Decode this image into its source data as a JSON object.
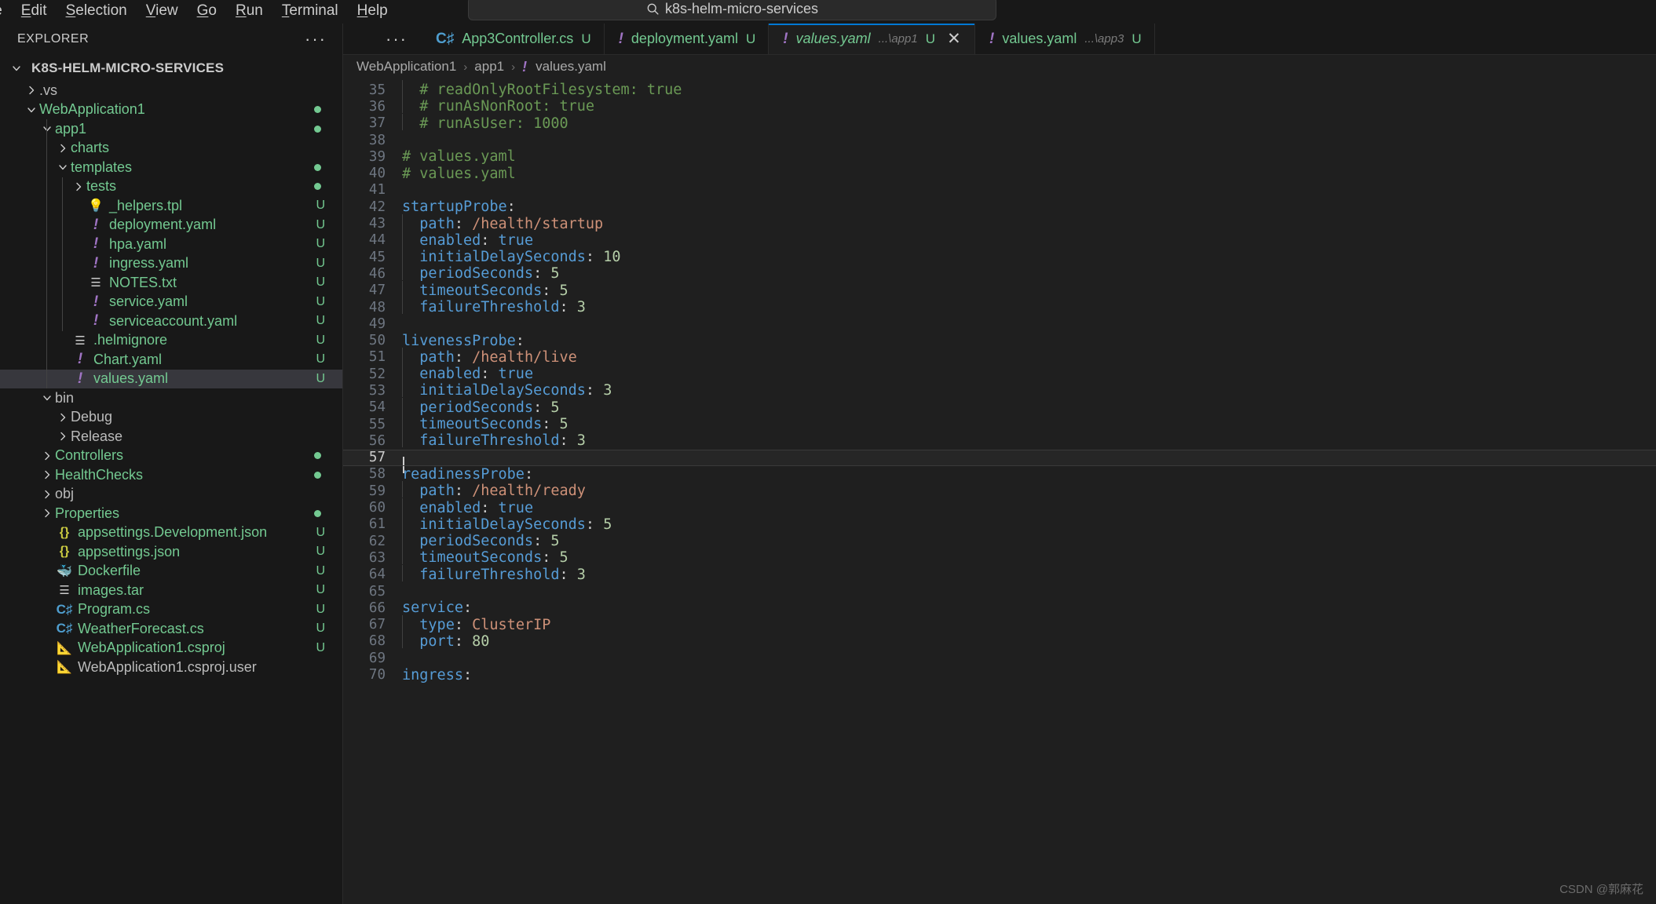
{
  "titlebar": {
    "menu": [
      "File",
      "Edit",
      "Selection",
      "View",
      "Go",
      "Run",
      "Terminal",
      "Help"
    ],
    "menu_first_visible": "le",
    "back_icon": "arrow-left-icon",
    "forward_icon": "arrow-right-icon",
    "search_icon": "search-icon",
    "search_value": "k8s-helm-micro-services"
  },
  "sidebar": {
    "title": "EXPLORER",
    "more_actions": "···",
    "root": "K8S-HELM-MICRO-SERVICES",
    "items": [
      {
        "label": ".vs",
        "indent": 1,
        "type": "folder",
        "state": "collapsed",
        "color": "dim"
      },
      {
        "label": "WebApplication1",
        "indent": 1,
        "type": "folder",
        "state": "expanded",
        "color": "mod",
        "dot": true
      },
      {
        "label": "app1",
        "indent": 2,
        "type": "folder",
        "state": "expanded",
        "color": "mod",
        "dot": true
      },
      {
        "label": "charts",
        "indent": 3,
        "type": "folder",
        "state": "collapsed",
        "color": "mod"
      },
      {
        "label": "templates",
        "indent": 3,
        "type": "folder",
        "state": "expanded",
        "color": "mod",
        "dot": true
      },
      {
        "label": "tests",
        "indent": 4,
        "type": "folder",
        "state": "collapsed",
        "color": "mod",
        "dot": true
      },
      {
        "label": "_helpers.tpl",
        "indent": 4,
        "type": "tpl",
        "color": "mod",
        "badge": "U"
      },
      {
        "label": "deployment.yaml",
        "indent": 4,
        "type": "yaml",
        "color": "mod",
        "badge": "U"
      },
      {
        "label": "hpa.yaml",
        "indent": 4,
        "type": "yaml",
        "color": "mod",
        "badge": "U"
      },
      {
        "label": "ingress.yaml",
        "indent": 4,
        "type": "yaml",
        "color": "mod",
        "badge": "U"
      },
      {
        "label": "NOTES.txt",
        "indent": 4,
        "type": "txt",
        "color": "mod",
        "badge": "U"
      },
      {
        "label": "service.yaml",
        "indent": 4,
        "type": "yaml",
        "color": "mod",
        "badge": "U"
      },
      {
        "label": "serviceaccount.yaml",
        "indent": 4,
        "type": "yaml",
        "color": "mod",
        "badge": "U"
      },
      {
        "label": ".helmignore",
        "indent": 3,
        "type": "txt",
        "color": "mod",
        "badge": "U"
      },
      {
        "label": "Chart.yaml",
        "indent": 3,
        "type": "yaml",
        "color": "mod",
        "badge": "U"
      },
      {
        "label": "values.yaml",
        "indent": 3,
        "type": "yaml",
        "color": "mod",
        "badge": "U",
        "selected": true
      },
      {
        "label": "bin",
        "indent": 2,
        "type": "folder",
        "state": "expanded",
        "color": "dim"
      },
      {
        "label": "Debug",
        "indent": 3,
        "type": "folder",
        "state": "collapsed",
        "color": "dim"
      },
      {
        "label": "Release",
        "indent": 3,
        "type": "folder",
        "state": "collapsed",
        "color": "dim"
      },
      {
        "label": "Controllers",
        "indent": 2,
        "type": "folder",
        "state": "collapsed",
        "color": "mod",
        "dot": true
      },
      {
        "label": "HealthChecks",
        "indent": 2,
        "type": "folder",
        "state": "collapsed",
        "color": "mod",
        "dot": true
      },
      {
        "label": "obj",
        "indent": 2,
        "type": "folder",
        "state": "collapsed",
        "color": "dim"
      },
      {
        "label": "Properties",
        "indent": 2,
        "type": "folder",
        "state": "collapsed",
        "color": "mod",
        "dot": true
      },
      {
        "label": "appsettings.Development.json",
        "indent": 2,
        "type": "json",
        "color": "mod",
        "badge": "U"
      },
      {
        "label": "appsettings.json",
        "indent": 2,
        "type": "json",
        "color": "mod",
        "badge": "U"
      },
      {
        "label": "Dockerfile",
        "indent": 2,
        "type": "docker",
        "color": "mod",
        "badge": "U"
      },
      {
        "label": "images.tar",
        "indent": 2,
        "type": "txt",
        "color": "mod",
        "badge": "U"
      },
      {
        "label": "Program.cs",
        "indent": 2,
        "type": "cs",
        "color": "mod",
        "badge": "U"
      },
      {
        "label": "WeatherForecast.cs",
        "indent": 2,
        "type": "cs",
        "color": "mod",
        "badge": "U"
      },
      {
        "label": "WebApplication1.csproj",
        "indent": 2,
        "type": "csproj",
        "color": "mod",
        "badge": "U"
      },
      {
        "label": "WebApplication1.csproj.user",
        "indent": 2,
        "type": "csproj",
        "color": "dim"
      }
    ]
  },
  "tabs": [
    {
      "label": "App3Controller.cs",
      "icon": "csharp-icon",
      "desc": "",
      "badge": "U",
      "active": false,
      "closable": false
    },
    {
      "label": "deployment.yaml",
      "icon": "yaml-icon",
      "desc": "",
      "badge": "U",
      "active": false,
      "closable": false
    },
    {
      "label": "values.yaml",
      "icon": "yaml-icon",
      "desc": "...\\app1",
      "badge": "U",
      "active": true,
      "closable": true,
      "close_icon": "close-icon"
    },
    {
      "label": "values.yaml",
      "icon": "yaml-icon",
      "desc": "...\\app3",
      "badge": "U",
      "active": false,
      "closable": false
    }
  ],
  "breadcrumbs": {
    "items": [
      "WebApplication1",
      "app1"
    ],
    "file": "values.yaml",
    "file_icon": "yaml-icon",
    "separator": "›"
  },
  "code": {
    "first_line": 35,
    "cursor_line": 57,
    "lines": [
      {
        "n": 35,
        "indent_guide": true,
        "tokens": [
          {
            "t": "  ",
            "c": "pun"
          },
          {
            "t": "# readOnlyRootFilesystem: true",
            "c": "com"
          }
        ]
      },
      {
        "n": 36,
        "indent_guide": true,
        "tokens": [
          {
            "t": "  ",
            "c": "pun"
          },
          {
            "t": "# runAsNonRoot: true",
            "c": "com"
          }
        ]
      },
      {
        "n": 37,
        "indent_guide": true,
        "tokens": [
          {
            "t": "  ",
            "c": "pun"
          },
          {
            "t": "# runAsUser: 1000",
            "c": "com"
          }
        ]
      },
      {
        "n": 38,
        "indent_guide": false,
        "tokens": []
      },
      {
        "n": 39,
        "indent_guide": false,
        "tokens": [
          {
            "t": "# values.yaml",
            "c": "com"
          }
        ]
      },
      {
        "n": 40,
        "indent_guide": false,
        "tokens": [
          {
            "t": "# values.yaml",
            "c": "com"
          }
        ]
      },
      {
        "n": 41,
        "indent_guide": false,
        "tokens": []
      },
      {
        "n": 42,
        "indent_guide": false,
        "tokens": [
          {
            "t": "startupProbe",
            "c": "key"
          },
          {
            "t": ":",
            "c": "pun"
          }
        ]
      },
      {
        "n": 43,
        "indent_guide": true,
        "tokens": [
          {
            "t": "  ",
            "c": "pun"
          },
          {
            "t": "path",
            "c": "key"
          },
          {
            "t": ": ",
            "c": "pun"
          },
          {
            "t": "/health/startup",
            "c": "str"
          }
        ]
      },
      {
        "n": 44,
        "indent_guide": true,
        "tokens": [
          {
            "t": "  ",
            "c": "pun"
          },
          {
            "t": "enabled",
            "c": "key"
          },
          {
            "t": ": ",
            "c": "pun"
          },
          {
            "t": "true",
            "c": "key"
          }
        ]
      },
      {
        "n": 45,
        "indent_guide": true,
        "tokens": [
          {
            "t": "  ",
            "c": "pun"
          },
          {
            "t": "initialDelaySeconds",
            "c": "key"
          },
          {
            "t": ": ",
            "c": "pun"
          },
          {
            "t": "10",
            "c": "num"
          }
        ]
      },
      {
        "n": 46,
        "indent_guide": true,
        "tokens": [
          {
            "t": "  ",
            "c": "pun"
          },
          {
            "t": "periodSeconds",
            "c": "key"
          },
          {
            "t": ": ",
            "c": "pun"
          },
          {
            "t": "5",
            "c": "num"
          }
        ]
      },
      {
        "n": 47,
        "indent_guide": true,
        "tokens": [
          {
            "t": "  ",
            "c": "pun"
          },
          {
            "t": "timeoutSeconds",
            "c": "key"
          },
          {
            "t": ": ",
            "c": "pun"
          },
          {
            "t": "5",
            "c": "num"
          }
        ]
      },
      {
        "n": 48,
        "indent_guide": true,
        "tokens": [
          {
            "t": "  ",
            "c": "pun"
          },
          {
            "t": "failureThreshold",
            "c": "key"
          },
          {
            "t": ": ",
            "c": "pun"
          },
          {
            "t": "3",
            "c": "num"
          }
        ]
      },
      {
        "n": 49,
        "indent_guide": false,
        "tokens": []
      },
      {
        "n": 50,
        "indent_guide": false,
        "tokens": [
          {
            "t": "livenessProbe",
            "c": "key"
          },
          {
            "t": ":",
            "c": "pun"
          }
        ]
      },
      {
        "n": 51,
        "indent_guide": true,
        "tokens": [
          {
            "t": "  ",
            "c": "pun"
          },
          {
            "t": "path",
            "c": "key"
          },
          {
            "t": ": ",
            "c": "pun"
          },
          {
            "t": "/health/live",
            "c": "str"
          }
        ]
      },
      {
        "n": 52,
        "indent_guide": true,
        "tokens": [
          {
            "t": "  ",
            "c": "pun"
          },
          {
            "t": "enabled",
            "c": "key"
          },
          {
            "t": ": ",
            "c": "pun"
          },
          {
            "t": "true",
            "c": "key"
          }
        ]
      },
      {
        "n": 53,
        "indent_guide": true,
        "tokens": [
          {
            "t": "  ",
            "c": "pun"
          },
          {
            "t": "initialDelaySeconds",
            "c": "key"
          },
          {
            "t": ": ",
            "c": "pun"
          },
          {
            "t": "3",
            "c": "num"
          }
        ]
      },
      {
        "n": 54,
        "indent_guide": true,
        "tokens": [
          {
            "t": "  ",
            "c": "pun"
          },
          {
            "t": "periodSeconds",
            "c": "key"
          },
          {
            "t": ": ",
            "c": "pun"
          },
          {
            "t": "5",
            "c": "num"
          }
        ]
      },
      {
        "n": 55,
        "indent_guide": true,
        "tokens": [
          {
            "t": "  ",
            "c": "pun"
          },
          {
            "t": "timeoutSeconds",
            "c": "key"
          },
          {
            "t": ": ",
            "c": "pun"
          },
          {
            "t": "5",
            "c": "num"
          }
        ]
      },
      {
        "n": 56,
        "indent_guide": true,
        "tokens": [
          {
            "t": "  ",
            "c": "pun"
          },
          {
            "t": "failureThreshold",
            "c": "key"
          },
          {
            "t": ": ",
            "c": "pun"
          },
          {
            "t": "3",
            "c": "num"
          }
        ]
      },
      {
        "n": 57,
        "indent_guide": false,
        "cursor": true,
        "tokens": []
      },
      {
        "n": 58,
        "indent_guide": false,
        "tokens": [
          {
            "t": "readinessProbe",
            "c": "key"
          },
          {
            "t": ":",
            "c": "pun"
          }
        ]
      },
      {
        "n": 59,
        "indent_guide": true,
        "tokens": [
          {
            "t": "  ",
            "c": "pun"
          },
          {
            "t": "path",
            "c": "key"
          },
          {
            "t": ": ",
            "c": "pun"
          },
          {
            "t": "/health/ready",
            "c": "str"
          }
        ]
      },
      {
        "n": 60,
        "indent_guide": true,
        "tokens": [
          {
            "t": "  ",
            "c": "pun"
          },
          {
            "t": "enabled",
            "c": "key"
          },
          {
            "t": ": ",
            "c": "pun"
          },
          {
            "t": "true",
            "c": "key"
          }
        ]
      },
      {
        "n": 61,
        "indent_guide": true,
        "tokens": [
          {
            "t": "  ",
            "c": "pun"
          },
          {
            "t": "initialDelaySeconds",
            "c": "key"
          },
          {
            "t": ": ",
            "c": "pun"
          },
          {
            "t": "5",
            "c": "num"
          }
        ]
      },
      {
        "n": 62,
        "indent_guide": true,
        "tokens": [
          {
            "t": "  ",
            "c": "pun"
          },
          {
            "t": "periodSeconds",
            "c": "key"
          },
          {
            "t": ": ",
            "c": "pun"
          },
          {
            "t": "5",
            "c": "num"
          }
        ]
      },
      {
        "n": 63,
        "indent_guide": true,
        "tokens": [
          {
            "t": "  ",
            "c": "pun"
          },
          {
            "t": "timeoutSeconds",
            "c": "key"
          },
          {
            "t": ": ",
            "c": "pun"
          },
          {
            "t": "5",
            "c": "num"
          }
        ]
      },
      {
        "n": 64,
        "indent_guide": true,
        "tokens": [
          {
            "t": "  ",
            "c": "pun"
          },
          {
            "t": "failureThreshold",
            "c": "key"
          },
          {
            "t": ": ",
            "c": "pun"
          },
          {
            "t": "3",
            "c": "num"
          }
        ]
      },
      {
        "n": 65,
        "indent_guide": false,
        "tokens": []
      },
      {
        "n": 66,
        "indent_guide": false,
        "tokens": [
          {
            "t": "service",
            "c": "key"
          },
          {
            "t": ":",
            "c": "pun"
          }
        ]
      },
      {
        "n": 67,
        "indent_guide": true,
        "tokens": [
          {
            "t": "  ",
            "c": "pun"
          },
          {
            "t": "type",
            "c": "key"
          },
          {
            "t": ": ",
            "c": "pun"
          },
          {
            "t": "ClusterIP",
            "c": "str"
          }
        ]
      },
      {
        "n": 68,
        "indent_guide": true,
        "tokens": [
          {
            "t": "  ",
            "c": "pun"
          },
          {
            "t": "port",
            "c": "key"
          },
          {
            "t": ": ",
            "c": "pun"
          },
          {
            "t": "80",
            "c": "num"
          }
        ]
      },
      {
        "n": 69,
        "indent_guide": false,
        "tokens": []
      },
      {
        "n": 70,
        "indent_guide": false,
        "tokens": [
          {
            "t": "ingress",
            "c": "key"
          },
          {
            "t": ":",
            "c": "pun"
          }
        ]
      }
    ]
  },
  "watermark": "CSDN @郭麻花",
  "colors": {
    "accent": "#0078d4",
    "modified": "#73c991",
    "yaml_icon": "#a074c4",
    "comment": "#6a9955",
    "key": "#569cd6",
    "string": "#ce9178",
    "number": "#b5cea8",
    "bg_editor": "#1f1f1f",
    "bg_chrome": "#181818"
  }
}
